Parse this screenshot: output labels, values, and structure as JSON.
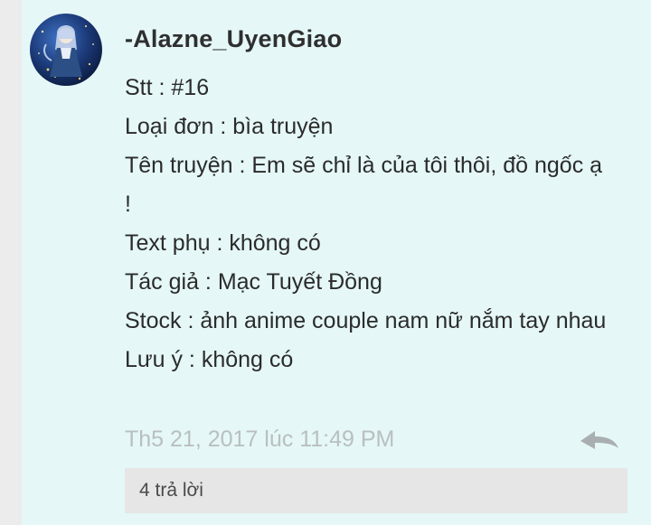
{
  "comment": {
    "username": "-Alazne_UyenGiao",
    "lines": [
      "Stt : #16",
      "Loại đơn : bìa truyện",
      "Tên truyện : Em sẽ chỉ là của tôi thôi, đồ ngốc ạ !",
      "Text phụ : không có",
      "Tác giả : Mạc Tuyết Đồng",
      "Stock : ảnh anime couple nam nữ nắm tay nhau",
      "Lưu ý : không có"
    ],
    "timestamp": "Th5 21, 2017 lúc 11:49 PM",
    "reply_icon": "reply-arrow-icon",
    "replies_label": "4 trả lời"
  },
  "colors": {
    "background": "#e5f7f7",
    "text": "#2b2b2b",
    "timestamp": "#b9bfc0",
    "reply_icon": "#a9afb0",
    "replies_bar": "#e6e6e6"
  }
}
